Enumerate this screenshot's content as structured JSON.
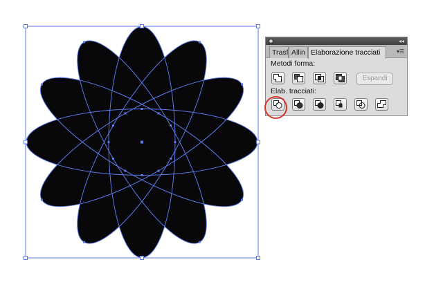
{
  "panel": {
    "tabs": [
      "Trasf",
      "Allin",
      "Elaborazione tracciati"
    ],
    "shape_modes_label": "Metodi forma:",
    "expand_label": "Espandi",
    "pathfinders_label": "Elab. tracciati:"
  },
  "colors": {
    "shape_fill": "#08080b",
    "path_stroke": "#5b79e8",
    "annotation_circle": "#d9352b"
  }
}
